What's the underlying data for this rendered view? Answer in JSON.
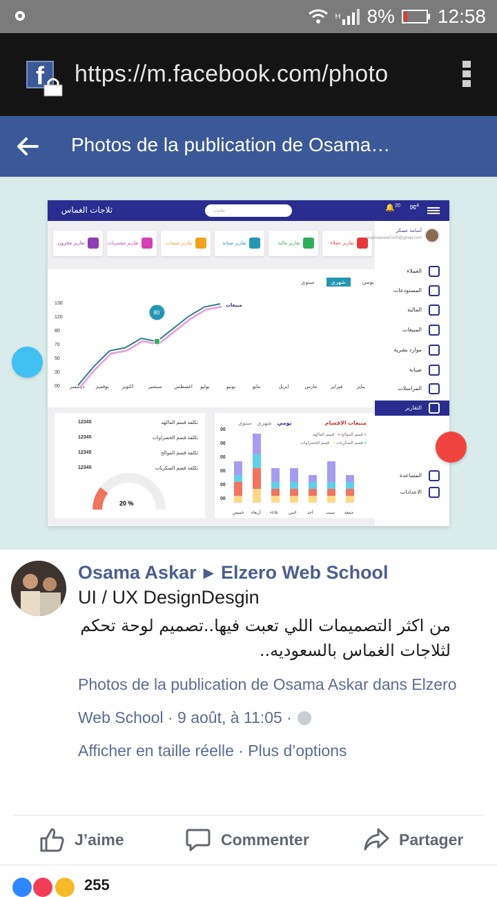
{
  "status_bar": {
    "battery_percent": "8%",
    "time": "12:58",
    "network_label": "H"
  },
  "browser": {
    "url": "https://m.facebook.com/photo"
  },
  "app_bar": {
    "title": "Photos de la publication de Osama…"
  },
  "dashboard": {
    "title": "ثلاجات الغماس",
    "search_placeholder": "بحث",
    "notif_count": "20",
    "mail_count": "4",
    "user_name": "أسامة عسكر",
    "user_email": "osamaaskar0100@gmail.com",
    "cards": [
      {
        "label": "تقارير مخزون",
        "color": "#8e3fb5"
      },
      {
        "label": "تقارير مشتريات",
        "color": "#d63fb5"
      },
      {
        "label": "تقارير مبيعات",
        "color": "#f0a21d"
      },
      {
        "label": "تقارير صيانة",
        "color": "#2497b3"
      },
      {
        "label": "تقارير مالية",
        "color": "#2fae5b"
      },
      {
        "label": "تقارير عملاء",
        "color": "#e5383b"
      }
    ],
    "nav": [
      {
        "label": "العملاء"
      },
      {
        "label": "المستودعات"
      },
      {
        "label": "المالية"
      },
      {
        "label": "المبيعات"
      },
      {
        "label": "موارد بشرية"
      },
      {
        "label": "صيانة"
      },
      {
        "label": "المراسلات"
      },
      {
        "label": "التقارير"
      },
      {
        "label": "المساعدة"
      },
      {
        "label": "الاعدادات"
      }
    ],
    "tabs": [
      "يومي",
      "شهري",
      "سنوي"
    ],
    "bottom_left": {
      "rows": [
        {
          "value": "12345",
          "label": "تكلفة قسم الفاكهه"
        },
        {
          "value": "12345",
          "label": "تكلفة قسم الخضراوات"
        },
        {
          "value": "12345",
          "label": "تكلفة قسم الموالح"
        },
        {
          "value": "12345",
          "label": "تكلفة قسم السكريات"
        }
      ],
      "gauge_value": "20 %"
    },
    "bottom_mid": {
      "title": "مبيعات الاقسام",
      "tabs": [
        "يومي",
        "شهري",
        "سنوي"
      ],
      "legend": [
        "قسم الفاكهه",
        "قسم الموالح",
        "قسم الخضراوات",
        "قسم السكريات"
      ]
    }
  },
  "chart_data": [
    {
      "type": "line",
      "title": "مبيعات",
      "categories": [
        "يناير",
        "فبراير",
        "مارس",
        "ابريل",
        "مايو",
        "يونيو",
        "يوليو",
        "اغسطس",
        "سبتمبر",
        "اكتوبر",
        "نوفمبر",
        "ديسمبر"
      ],
      "y_ticks": [
        "00",
        "30",
        "50",
        "70",
        "80",
        "120",
        "130"
      ],
      "series": [
        {
          "name": "مبيعات",
          "values": [
            0,
            30,
            55,
            60,
            75,
            70,
            90,
            110,
            125,
            130
          ]
        }
      ],
      "highlight": {
        "label": "80"
      }
    },
    {
      "type": "bar",
      "stacked": true,
      "title": "مبيعات الاقسام",
      "categories": [
        "جمعة",
        "سبت",
        "أحد",
        "اثنين",
        "ثلاثاء",
        "أربعاء",
        "خميس"
      ],
      "y_ticks": [
        "00",
        "00",
        "00",
        "00",
        "00",
        "00"
      ],
      "series": [
        {
          "name": "قسم الفاكهه",
          "color": "#a59cf0",
          "values": [
            2,
            3,
            2,
            2,
            1,
            3,
            1
          ]
        },
        {
          "name": "قسم الخضراوات",
          "color": "#5fd0e8",
          "values": [
            1,
            2,
            1,
            1,
            1,
            1,
            1
          ]
        },
        {
          "name": "قسم الموالح",
          "color": "#f07560",
          "values": [
            2,
            3,
            1,
            1,
            1,
            1,
            1
          ]
        },
        {
          "name": "قسم السكريات",
          "color": "#ffd88a",
          "values": [
            1,
            2,
            1,
            1,
            1,
            1,
            1
          ]
        }
      ]
    }
  ],
  "post": {
    "author": "Osama Askar",
    "group": "Elzero Web School",
    "title": "UI / UX DesignDesgin",
    "body": "من اكثر التصميمات اللي تعبت فيها..تصميم لوحة تحكم لثلاجات الغماس بالسعوديه..",
    "link1": "Photos de la publication de Osama Askar dans Elzero",
    "link2_prefix": "Web School · 9 août, à 11:05 ·",
    "link3": "Afficher en taille réelle · Plus d’options",
    "actions": {
      "like": "J’aime",
      "comment": "Commenter",
      "share": "Partager"
    },
    "reaction_count": "255"
  }
}
